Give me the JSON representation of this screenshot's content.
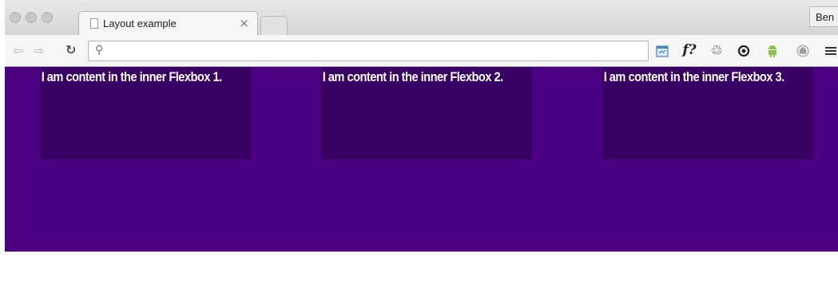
{
  "browser": {
    "tab_title": "Layout example",
    "tab_close": "×",
    "profile_label": "Ben",
    "address_value": "",
    "fonts_extension_label": "f?"
  },
  "icons": {
    "back": "back-arrow-icon",
    "forward": "forward-arrow-icon",
    "reload": "reload-icon",
    "search": "search-icon",
    "extensions": [
      "calendar-icon",
      "fonts-icon",
      "recycle-icon",
      "sync-icon",
      "android-icon",
      "hand-icon",
      "menu-icon"
    ]
  },
  "page": {
    "background_color": "#4b0082",
    "inner_box_color": "#380062",
    "boxes": [
      {
        "text": "I am content in the inner Flexbox 1."
      },
      {
        "text": "I am content in the inner Flexbox 2."
      },
      {
        "text": "I am content in the inner Flexbox 3."
      }
    ]
  }
}
